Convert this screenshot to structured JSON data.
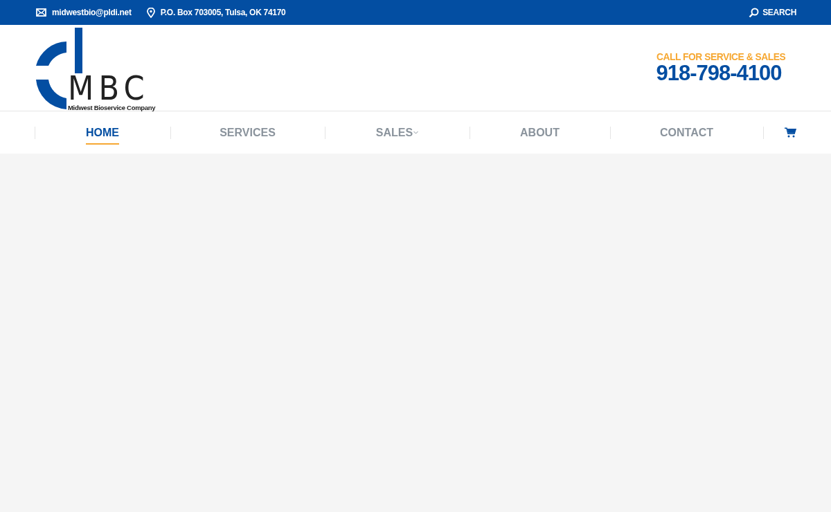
{
  "top_bar": {
    "email": "midwestbio@pldi.net",
    "address": "P.O. Box 703005, Tulsa, OK 74170",
    "search_label": "SEARCH"
  },
  "header": {
    "logo": {
      "letters": "MBC",
      "tagline": "Midwest Bioservice Company"
    },
    "call_label": "CALL FOR SERVICE & SALES",
    "phone": "918-798-4100"
  },
  "nav": [
    {
      "label": "HOME",
      "selected": true,
      "dropdown": false
    },
    {
      "label": "SERVICES",
      "selected": false,
      "dropdown": false
    },
    {
      "label": "SALES",
      "selected": false,
      "dropdown": true
    },
    {
      "label": "ABOUT",
      "selected": false,
      "dropdown": false
    },
    {
      "label": "CONTACT",
      "selected": false,
      "dropdown": false
    }
  ]
}
